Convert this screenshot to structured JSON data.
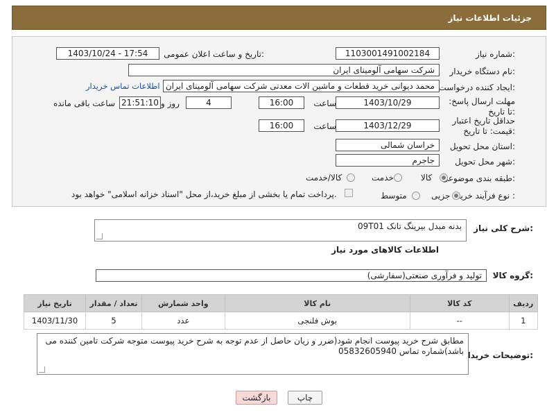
{
  "page": {
    "title": "جزئیات اطلاعات نیاز"
  },
  "form": {
    "need_number_label": "شماره نیاز:",
    "need_number": "1103001491002184",
    "announce_label": "تاریخ و ساعت اعلان عمومی:",
    "announce_value": "1403/10/24 - 17:54",
    "buyer_org_label": "نام دستگاه خریدار:",
    "buyer_org": "شرکت سهامی آلومینای ایران",
    "creator_label": "ایجاد کننده درخواست:",
    "creator": "محمد دیوانی خرید قطعات و ماشین الات معدنی شرکت سهامی آلومینای ایران",
    "contact_link": "اطلاعات تماس خریدار",
    "reply_deadline_label": "مهلت ارسال پاسخ: تا تاریخ:",
    "reply_date": "1403/10/29",
    "time_label": "ساعت",
    "reply_time": "16:00",
    "days_value": "4",
    "days_label": "روز و",
    "remaining_time": "21:51:10",
    "remaining_label": "ساعت باقی مانده",
    "price_validity_label": "حداقل تاریخ اعتبار قیمت: تا تاریخ:",
    "price_date": "1403/12/29",
    "price_time": "16:00",
    "province_label": "استان محل تحویل:",
    "province": "خراسان شمالی",
    "city_label": "شهر محل تحویل:",
    "city": "جاجرم",
    "category_label": "طبقه بندی موضوعی:",
    "category_options": [
      "کالا",
      "خدمت",
      "کالا/خدمت"
    ],
    "process_label": "نوع فرآیند خرید :",
    "process_options": [
      "جزیی",
      "متوسط"
    ],
    "payment_note": "پرداخت تمام یا بخشی از مبلغ خرید،از محل \"اسناد خزانه اسلامی\" خواهد بود."
  },
  "description": {
    "label": "شرح کلی نیاز:",
    "value": "بدنه مبدل بیرینگ  تانک 09T01"
  },
  "goods_info_title": "اطلاعات کالاهای مورد نیاز",
  "goods_group": {
    "label": "گروه کالا:",
    "value": "تولید و فرآوری صنعتی(سفارشی)"
  },
  "table": {
    "headers": [
      "ردیف",
      "کد کالا",
      "نام کالا",
      "واحد شمارش",
      "تعداد / مقدار",
      "تاریخ نیاز"
    ],
    "rows": [
      [
        "1",
        "--",
        "بوش فلنجی",
        "عدد",
        "5",
        "1403/11/30"
      ]
    ]
  },
  "buyer_notes": {
    "label": "توضیحات خریدار:",
    "value": "مطابق شرح خرید پیوست انجام شود(ضرر و زیان حاصل از عدم توجه به شرح خرید پیوست متوجه شرکت تامین کننده می باشد)شماره تماس 05832605940"
  },
  "buttons": {
    "print": "چاپ",
    "back": "بازگشت"
  },
  "colors": {
    "title_bar": "#8a6d3b",
    "panel_bg": "#f4f4f4",
    "table_header": "#d4d4d4",
    "back_button": "#f8d9d9"
  }
}
